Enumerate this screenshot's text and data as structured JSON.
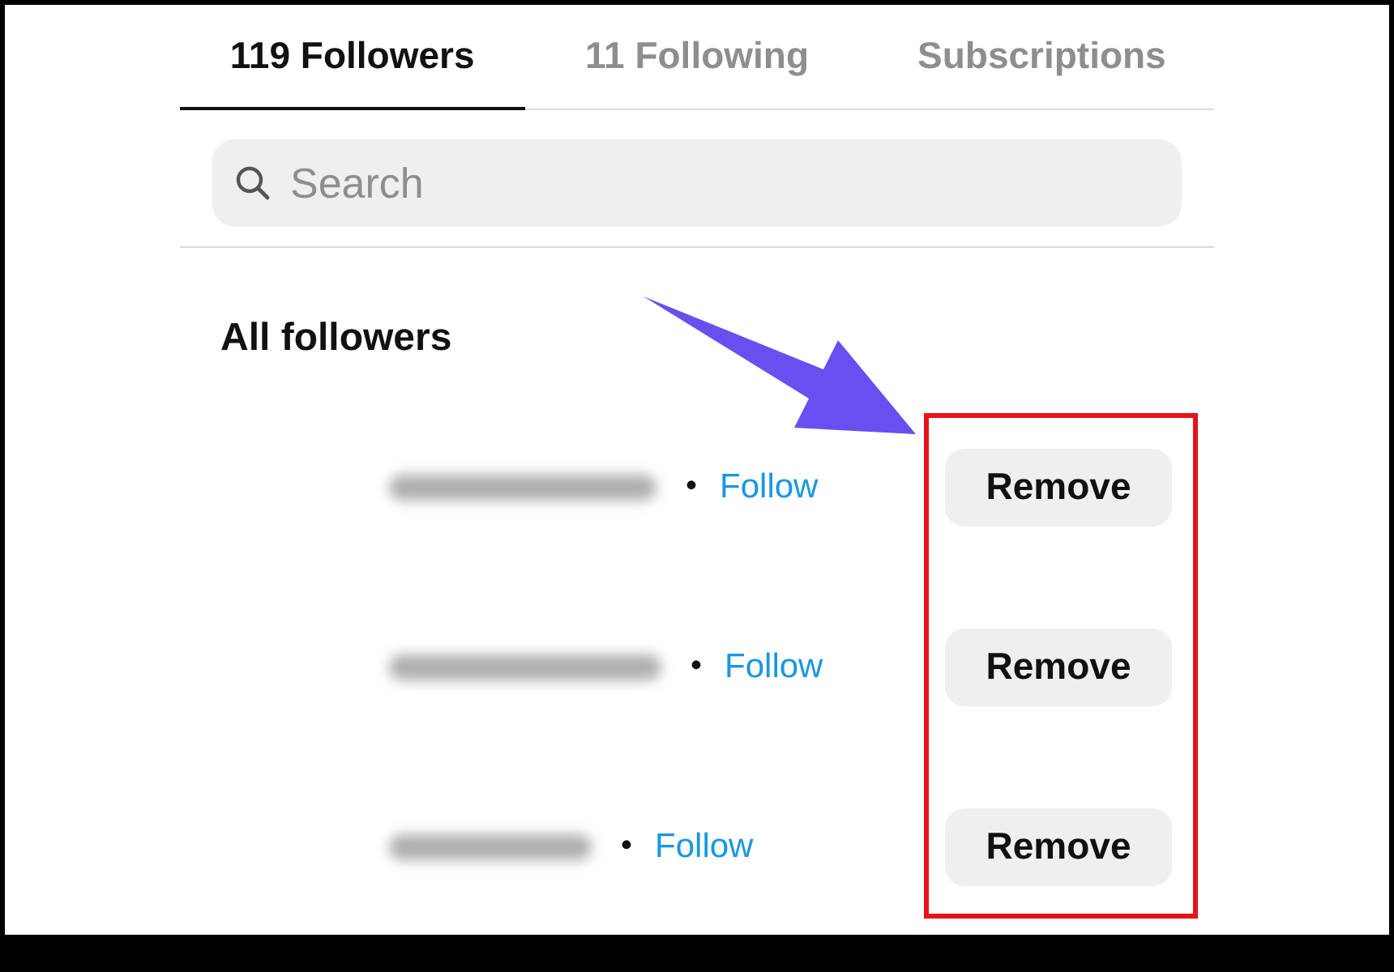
{
  "tabs": [
    {
      "label": "119 Followers",
      "selected": true
    },
    {
      "label": "11 Following",
      "selected": false
    },
    {
      "label": "Subscriptions",
      "selected": false
    }
  ],
  "search": {
    "placeholder": "Search"
  },
  "section_title": "All followers",
  "followers": [
    {
      "separator": "•",
      "follow_label": "Follow",
      "remove_label": "Remove"
    },
    {
      "separator": "•",
      "follow_label": "Follow",
      "remove_label": "Remove"
    },
    {
      "separator": "•",
      "follow_label": "Follow",
      "remove_label": "Remove"
    }
  ]
}
